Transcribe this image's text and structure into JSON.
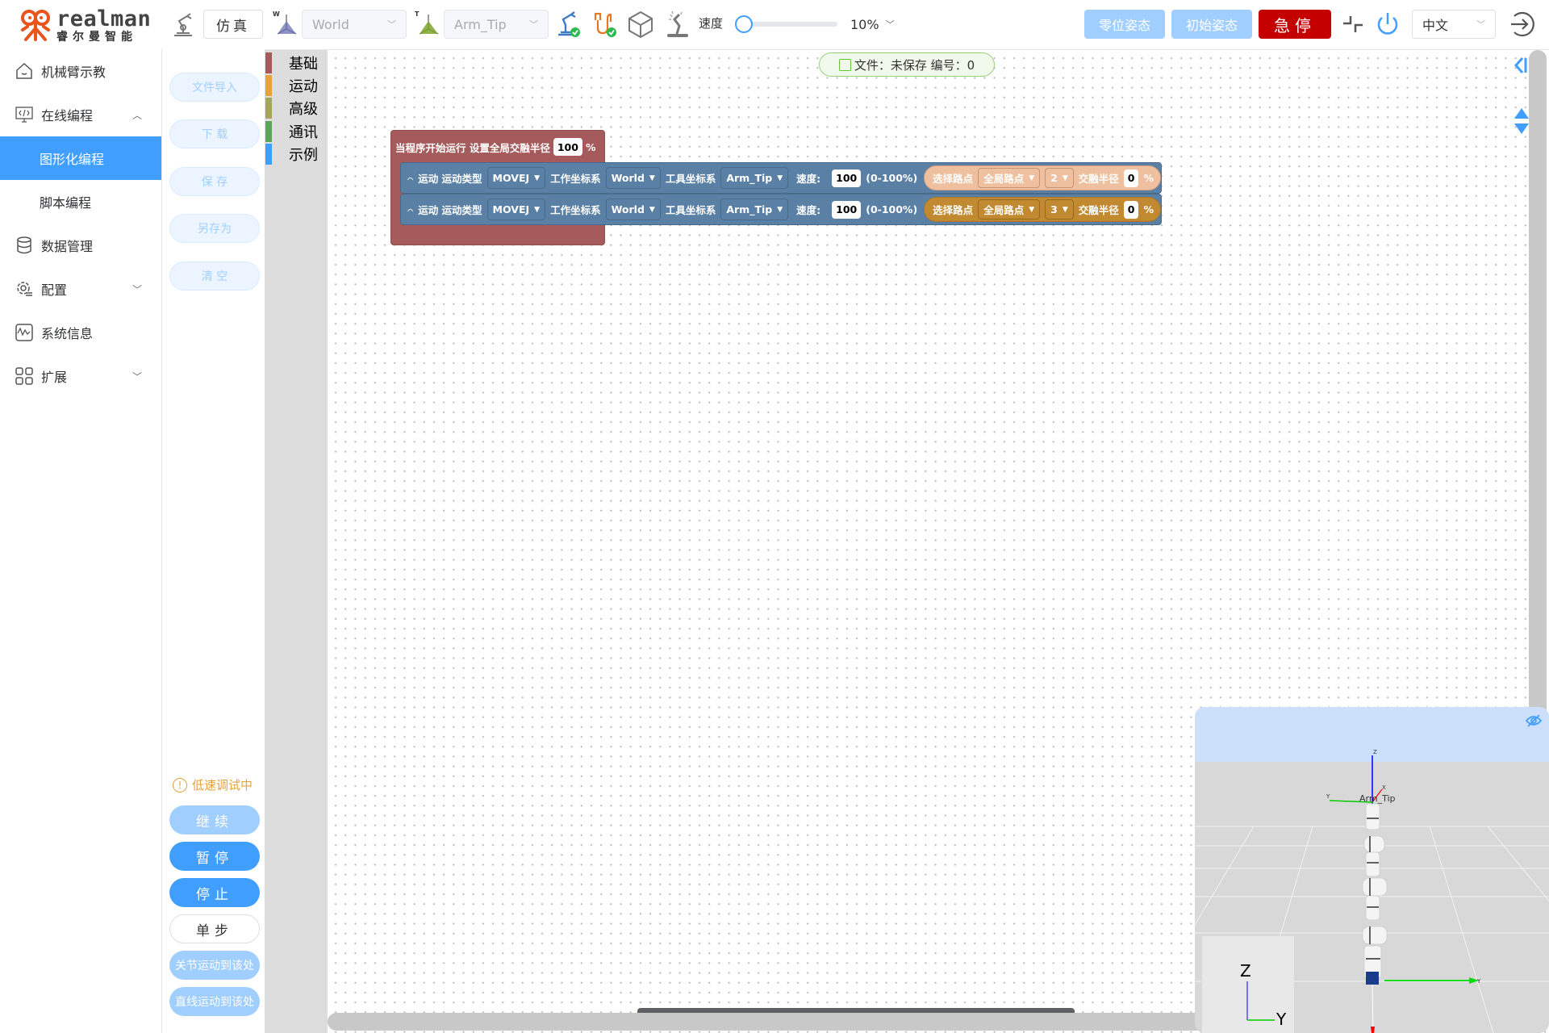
{
  "brand": {
    "name_en": "realman",
    "name_cn": "睿尔曼智能",
    "logo_color": "#e8541c"
  },
  "header": {
    "mode_button": "仿真",
    "work_frame_badge": "W",
    "work_frame_select": "World",
    "tool_frame_badge": "T",
    "tool_frame_select": "Arm_Tip",
    "speed_label": "速度",
    "speed_value": "10%",
    "speed_fraction": 0.1,
    "zero_pose_button": "零位姿态",
    "initial_pose_button": "初始姿态",
    "estop_button": "急停",
    "language_select": "中文",
    "colors": {
      "primary": "#409eff",
      "primary_light": "#a0cfff",
      "estop": "#c40000"
    }
  },
  "sidebar": {
    "items": [
      {
        "label": "机械臂示教",
        "icon": "home-icon"
      },
      {
        "label": "在线编程",
        "icon": "code-monitor-icon",
        "expanded": true
      },
      {
        "label": "图形化编程",
        "sub": true,
        "active": true
      },
      {
        "label": "脚本编程",
        "sub": true
      },
      {
        "label": "数据管理",
        "icon": "database-icon"
      },
      {
        "label": "配置",
        "icon": "settings-icon",
        "expandable": true
      },
      {
        "label": "系统信息",
        "icon": "pulse-icon"
      },
      {
        "label": "扩展",
        "icon": "grid-icon",
        "expandable": true
      }
    ]
  },
  "file_actions": {
    "import": "文件导入",
    "download": "下 载",
    "save": "保 存",
    "save_as": "另存为",
    "clear": "清 空"
  },
  "run_controls": {
    "status": "低速调试中",
    "continue": "继续",
    "pause": "暂停",
    "stop": "停止",
    "step": "单步",
    "joint_move_here": "关节运动到该处",
    "linear_move_here": "直线运动到该处"
  },
  "palette": {
    "categories": [
      {
        "label": "基础",
        "color": "#a55b5b"
      },
      {
        "label": "运动",
        "color": "#e6a23c"
      },
      {
        "label": "高级",
        "color": "#a5a55b"
      },
      {
        "label": "通讯",
        "color": "#5ba55b"
      },
      {
        "label": "示例",
        "color": "#409eff"
      }
    ]
  },
  "canvas": {
    "file_status": "文件：未保存  编号：0",
    "start_block": {
      "label": "当程序开始运行 设置全局交融半径",
      "blend_radius": "100",
      "unit": "%"
    },
    "move_blocks": [
      {
        "label": "运动 运动类型",
        "move_type": "MOVEJ",
        "work_frame_label": "工作坐标系",
        "work_frame": "World",
        "tool_frame_label": "工具坐标系",
        "tool_frame": "Arm_Tip",
        "speed_label": "速度:",
        "speed": "100",
        "speed_range": "(0-100%)",
        "waypoint_label": "选择路点",
        "waypoint_scope": "全局路点",
        "waypoint_index": "2",
        "blend_label": "交融半径",
        "blend": "0",
        "blend_unit": "%"
      },
      {
        "label": "运动 运动类型",
        "move_type": "MOVEJ",
        "work_frame_label": "工作坐标系",
        "work_frame": "World",
        "tool_frame_label": "工具坐标系",
        "tool_frame": "Arm_Tip",
        "speed_label": "速度:",
        "speed": "100",
        "speed_range": "(0-100%)",
        "waypoint_label": "选择路点",
        "waypoint_scope": "全局路点",
        "waypoint_index": "3",
        "blend_label": "交融半径",
        "blend": "0",
        "blend_unit": "%"
      }
    ]
  },
  "viewer3d": {
    "tool_frame_label": "Arm_Tip",
    "axis_z": "Z",
    "axis_y": "Y",
    "axis_x": "X",
    "gizmo_z": "Z",
    "gizmo_y": "Y"
  }
}
